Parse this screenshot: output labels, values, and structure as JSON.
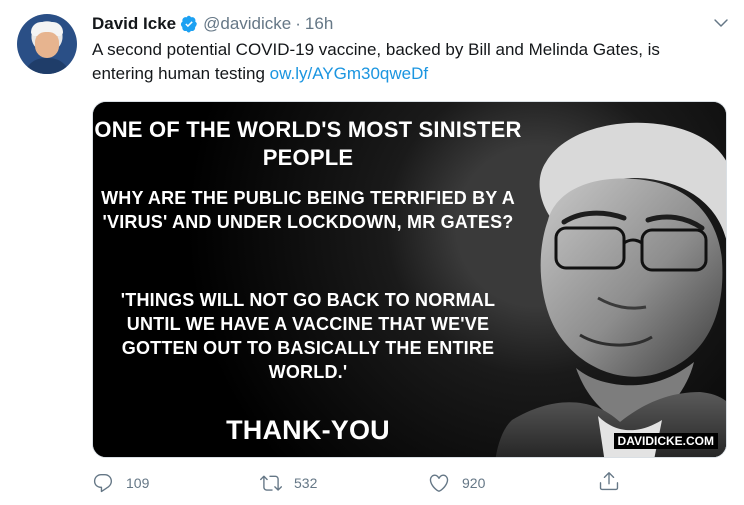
{
  "tweet": {
    "author": {
      "name": "David Icke",
      "handle": "@davidicke",
      "separator": "·",
      "time": "16h"
    },
    "text": {
      "main": "A second potential COVID-19 vaccine, backed by Bill and Melinda Gates, is entering human testing ",
      "link": "ow.ly/AYGm30qweDf"
    },
    "media": {
      "lines": [
        "ONE OF THE WORLD'S MOST SINISTER PEOPLE",
        "WHY ARE THE PUBLIC BEING TERRIFIED BY A 'VIRUS' AND UNDER LOCKDOWN, MR GATES?",
        "'THINGS WILL NOT GO BACK TO NORMAL UNTIL WE HAVE A VACCINE THAT WE'VE GOTTEN OUT TO BASICALLY THE ENTIRE WORLD.'",
        "THANK-YOU"
      ],
      "watermark": "DAVIDICKE.COM"
    },
    "actions": {
      "reply_count": "109",
      "retweet_count": "532",
      "like_count": "920"
    },
    "colors": {
      "link": "#1b95e0",
      "muted": "#657786",
      "verified": "#1da1f2"
    },
    "icons": {
      "verified": "verified-badge-icon",
      "caret": "chevron-down-icon",
      "reply": "reply-icon",
      "retweet": "retweet-icon",
      "like": "heart-icon",
      "share": "share-icon"
    }
  }
}
